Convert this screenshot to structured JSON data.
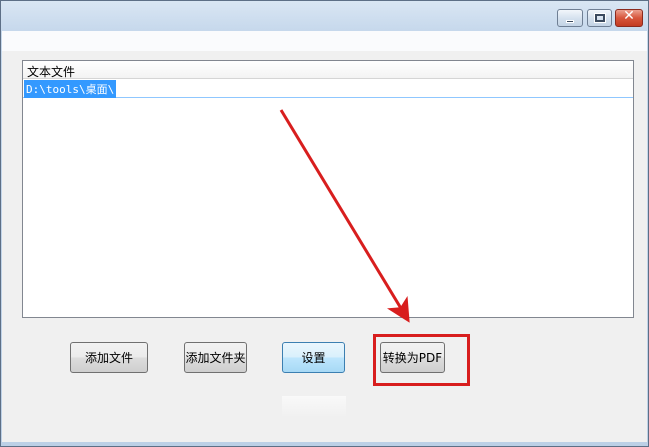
{
  "window": {
    "controls": {
      "minimize_icon": "minimize-icon",
      "maximize_icon": "maximize-icon",
      "close_glyph": "✕"
    }
  },
  "file_list": {
    "column_header": "文本文件",
    "rows": [
      {
        "path": "D:\\tools\\桌面\\",
        "selected": true
      }
    ]
  },
  "buttons": {
    "add_file": "添加文件",
    "add_folder": "添加文件夹",
    "settings": "设置",
    "convert": "转换为PDF"
  },
  "annotation": {
    "highlight_color": "#d81e1e",
    "arrow_color": "#d81e1e"
  }
}
